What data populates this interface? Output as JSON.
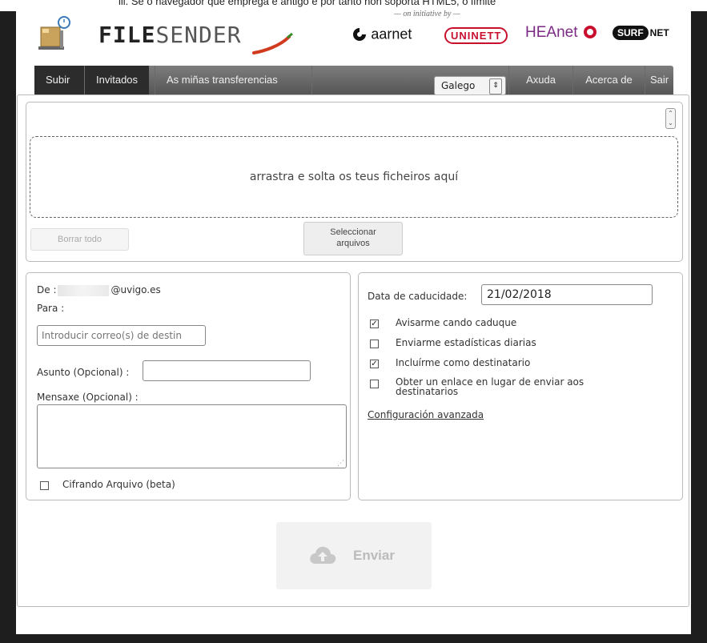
{
  "top_notice": "iii. Se o navegador que emprega é antigo e por tanto non soporta HTML5, o límite",
  "header": {
    "logo_name": "FILESENDER",
    "logo_bold": "FILE",
    "logo_light": "SENDER",
    "initiative": "— on initiative by —",
    "partners": [
      "aarnet",
      "UNINETT",
      "HEAnet",
      "SURF",
      "NET"
    ]
  },
  "nav": {
    "items": [
      "Subir",
      "Invitados",
      "As miñas transferencias"
    ],
    "language": "Galego",
    "right_items": [
      "Axuda",
      "Acerca de",
      "Sair"
    ]
  },
  "upload": {
    "dropzone_text": "arrastra e solta os teus ficheiros aquí",
    "clear_all": "Borrar todo",
    "select_files": [
      "Seleccionar",
      "arquivos"
    ]
  },
  "form": {
    "from_label": "De :",
    "from_email": "@uvigo.es",
    "to_label": "Para :",
    "to_placeholder": "Introducir correo(s) de destin",
    "subject_label": "Asunto (Opcional) :",
    "message_label": "Mensaxe (Opcional) :",
    "encrypt_label": "Cifrando Arquivo (beta)",
    "encrypt_checked": false
  },
  "options": {
    "expiry_label": "Data de caducidade:",
    "expiry_value": "21/02/2018",
    "checkboxes": [
      {
        "label": "Avisarme cando caduque",
        "checked": true
      },
      {
        "label": "Enviarme estadísticas diarias",
        "checked": false
      },
      {
        "label": "Incluírme como destinatario",
        "checked": true
      },
      {
        "label": "Obter un enlace en lugar de enviar aos",
        "label2": "destinatarios",
        "checked": false
      }
    ],
    "advanced_link": "Configuración avanzada"
  },
  "send_button": "Enviar",
  "colors": {
    "nav_bg": "#555555",
    "nav_active": "#2c2c2c",
    "chili": "#d03a1e",
    "unin": "#c8102e",
    "heanet": "#7a2a82"
  }
}
